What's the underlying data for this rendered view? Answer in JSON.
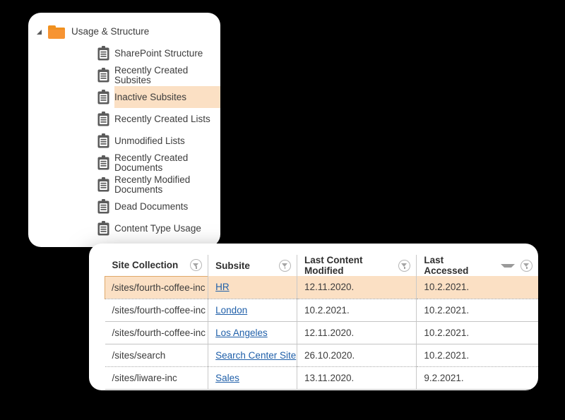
{
  "tree": {
    "root": {
      "label": "Usage & Structure",
      "icon": "folder-icon",
      "twisty": "expanded-triangle-icon"
    },
    "items": [
      {
        "label": "SharePoint Structure",
        "icon": "clipboard-icon",
        "selected": false
      },
      {
        "label": "Recently Created Subsites",
        "icon": "clipboard-icon",
        "selected": false
      },
      {
        "label": "Inactive Subsites",
        "icon": "clipboard-icon",
        "selected": true
      },
      {
        "label": "Recently Created Lists",
        "icon": "clipboard-icon",
        "selected": false
      },
      {
        "label": "Unmodified Lists",
        "icon": "clipboard-icon",
        "selected": false
      },
      {
        "label": "Recently Created Documents",
        "icon": "clipboard-icon",
        "selected": false
      },
      {
        "label": "Recently Modified Documents",
        "icon": "clipboard-icon",
        "selected": false
      },
      {
        "label": "Dead Documents",
        "icon": "clipboard-icon",
        "selected": false
      },
      {
        "label": "Content Type Usage",
        "icon": "clipboard-icon",
        "selected": false
      }
    ]
  },
  "table": {
    "columns": [
      {
        "label": "Site Collection",
        "filter_icon": "filter-icon",
        "sorted": false
      },
      {
        "label": "Subsite",
        "filter_icon": "filter-icon",
        "sorted": false
      },
      {
        "label": "Last Content Modified",
        "filter_icon": "filter-icon",
        "sorted": false
      },
      {
        "label": "Last Accessed",
        "filter_icon": "filter-icon",
        "sorted": true,
        "sort_icon": "sort-descending-caret-icon"
      }
    ],
    "rows": [
      {
        "selected": true,
        "site_collection": "/sites/fourth-coffee-inc",
        "subsite": "HR",
        "last_content_modified": "12.11.2020.",
        "last_accessed": "10.2.2021."
      },
      {
        "selected": false,
        "site_collection": "/sites/fourth-coffee-inc",
        "subsite": "London",
        "last_content_modified": "10.2.2021.",
        "last_accessed": "10.2.2021."
      },
      {
        "selected": false,
        "site_collection": "/sites/fourth-coffee-inc",
        "subsite": "Los Angeles",
        "last_content_modified": "12.11.2020.",
        "last_accessed": "10.2.2021."
      },
      {
        "selected": false,
        "site_collection": "/sites/search",
        "subsite": "Search Center Site",
        "last_content_modified": "26.10.2020.",
        "last_accessed": "10.2.2021."
      },
      {
        "selected": false,
        "site_collection": "/sites/liware-inc",
        "subsite": "Sales",
        "last_content_modified": "13.11.2020.",
        "last_accessed": "9.2.2021."
      }
    ]
  },
  "colors": {
    "background": "#000000",
    "card": "#ffffff",
    "highlight": "#fbe0c4",
    "highlight_border": "#e0a86a",
    "folder": "#f79433",
    "link": "#1f5fa9",
    "text": "#3c3c3c",
    "icon_gray": "#5a5a5a"
  }
}
